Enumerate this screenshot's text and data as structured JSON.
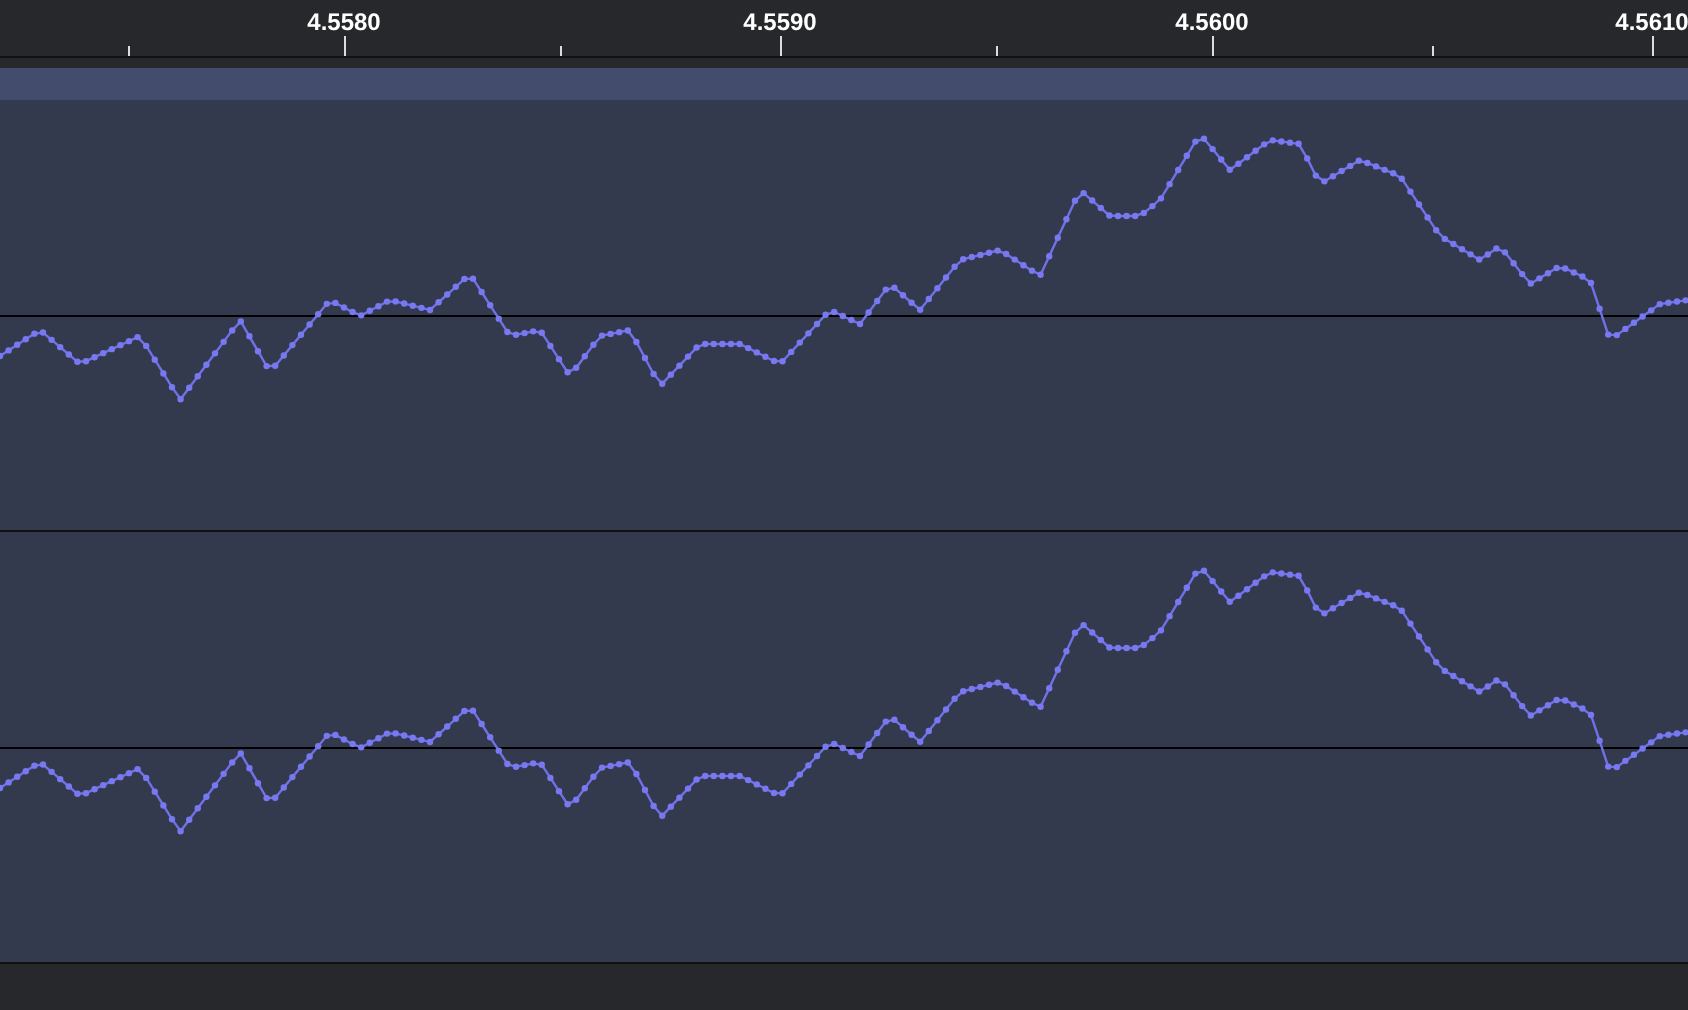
{
  "ruler": {
    "labels": [
      "4.5580",
      "4.5590",
      "4.5600",
      "4.5610"
    ]
  },
  "channels": [
    {
      "kind": "wave"
    },
    {
      "kind": "wave"
    }
  ]
}
